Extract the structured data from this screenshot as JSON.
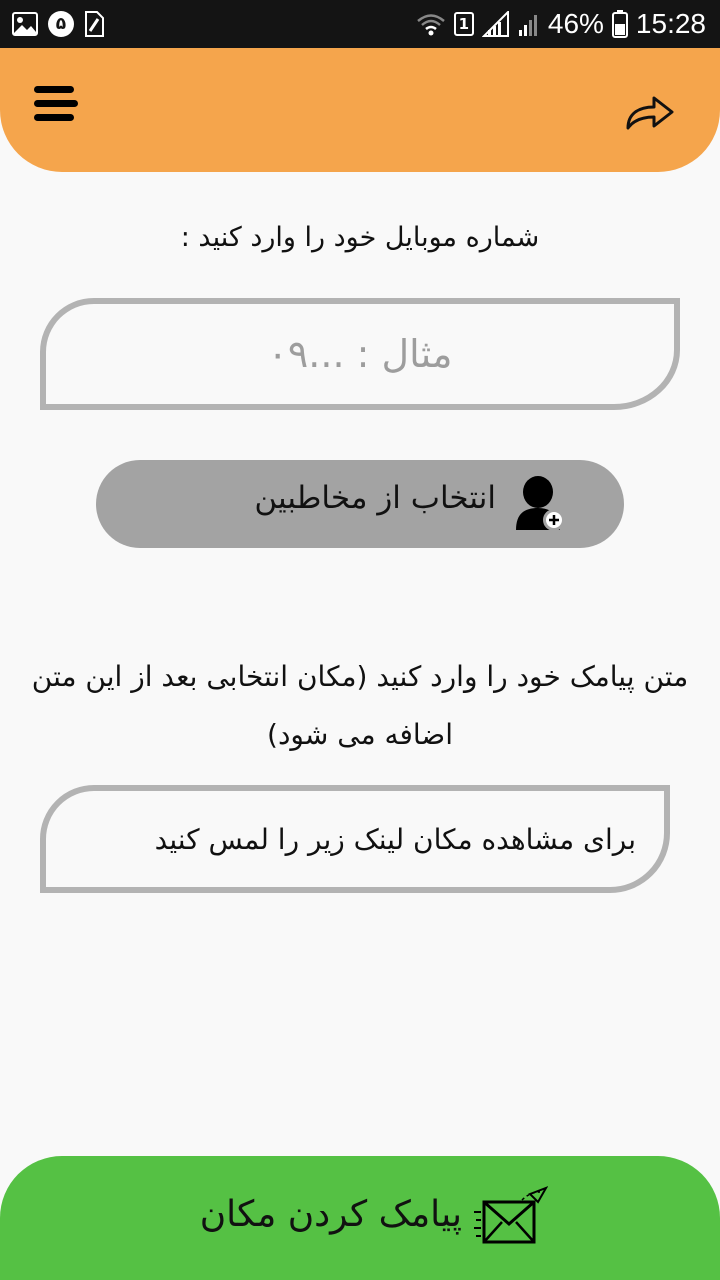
{
  "status_bar": {
    "left_icons": [
      "gallery-icon",
      "notification-count-icon",
      "sim-card-icon"
    ],
    "notification_count": "۵",
    "sim_slot": "1",
    "battery_percent": "46%",
    "time": "15:28",
    "right_icons": [
      "wifi-icon",
      "sim-slot-icon",
      "signal-icon",
      "signal-icon-2",
      "battery-icon"
    ]
  },
  "header": {
    "background_color": "#f5a54c",
    "menu_icon": "menu-icon",
    "share_icon": "share-arrow-icon"
  },
  "phone_section": {
    "label": "شماره موبایل خود را وارد کنید :",
    "input_placeholder": "مثال : ...۰۹",
    "input_value": ""
  },
  "contacts_button": {
    "label": "انتخاب از مخاطبین",
    "icon": "add-contact-icon",
    "background_color": "#a3a3a3"
  },
  "sms_section": {
    "label": "متن پیامک خود را وارد کنید (مکان انتخابی بعد از این متن اضافه می شود)",
    "input_value": "برای مشاهده مکان لینک زیر را لمس کنید"
  },
  "send_button": {
    "label": "پیامک کردن مکان",
    "icon": "send-mail-icon",
    "background_color": "#55c144"
  }
}
